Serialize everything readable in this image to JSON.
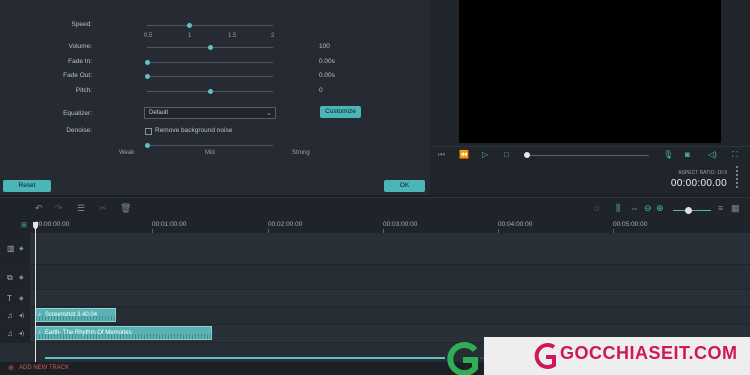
{
  "audio": {
    "speed": {
      "label": "Speed:",
      "ticks": [
        "0.5",
        "1",
        "1.5",
        "2"
      ]
    },
    "volume": {
      "label": "Volume:",
      "value": "100"
    },
    "fade_in": {
      "label": "Fade In:",
      "value": "0.00s"
    },
    "fade_out": {
      "label": "Fade Out:",
      "value": "0.00s"
    },
    "pitch": {
      "label": "Pitch:",
      "value": "0"
    },
    "equalizer": {
      "label": "Equalizer:",
      "selected": "Default",
      "customize_label": "Customize"
    },
    "denoise": {
      "label": "Denoise:",
      "checkbox_label": "Remove background noise",
      "levels": [
        "Weak",
        "Mid",
        "Strong"
      ]
    },
    "reset_label": "Reset",
    "ok_label": "OK"
  },
  "preview": {
    "aspect_ratio_label": "ASPECT RATIO: 16:9",
    "timecode": "00:00:00.00"
  },
  "ruler": {
    "ticks": [
      "00:00:00:00",
      "00:01:00:00",
      "00:02:00:00",
      "00:03:00:00",
      "00:04:00:00",
      "00:05:00:00"
    ]
  },
  "tracks": {
    "clips": [
      {
        "name": "Screenshot 3.40.04"
      },
      {
        "name": "Earth- The Rhythm Of Memories"
      }
    ]
  },
  "footer": {
    "add_track_label": "ADD NEW TRACK"
  },
  "watermark": {
    "text": "GOCCHIASEIT.COM"
  },
  "colors": {
    "accent": "#4bb5b8",
    "background": "#1b2027",
    "panel": "#262b33",
    "danger": "#d6584e",
    "watermark": "#d0175c"
  }
}
